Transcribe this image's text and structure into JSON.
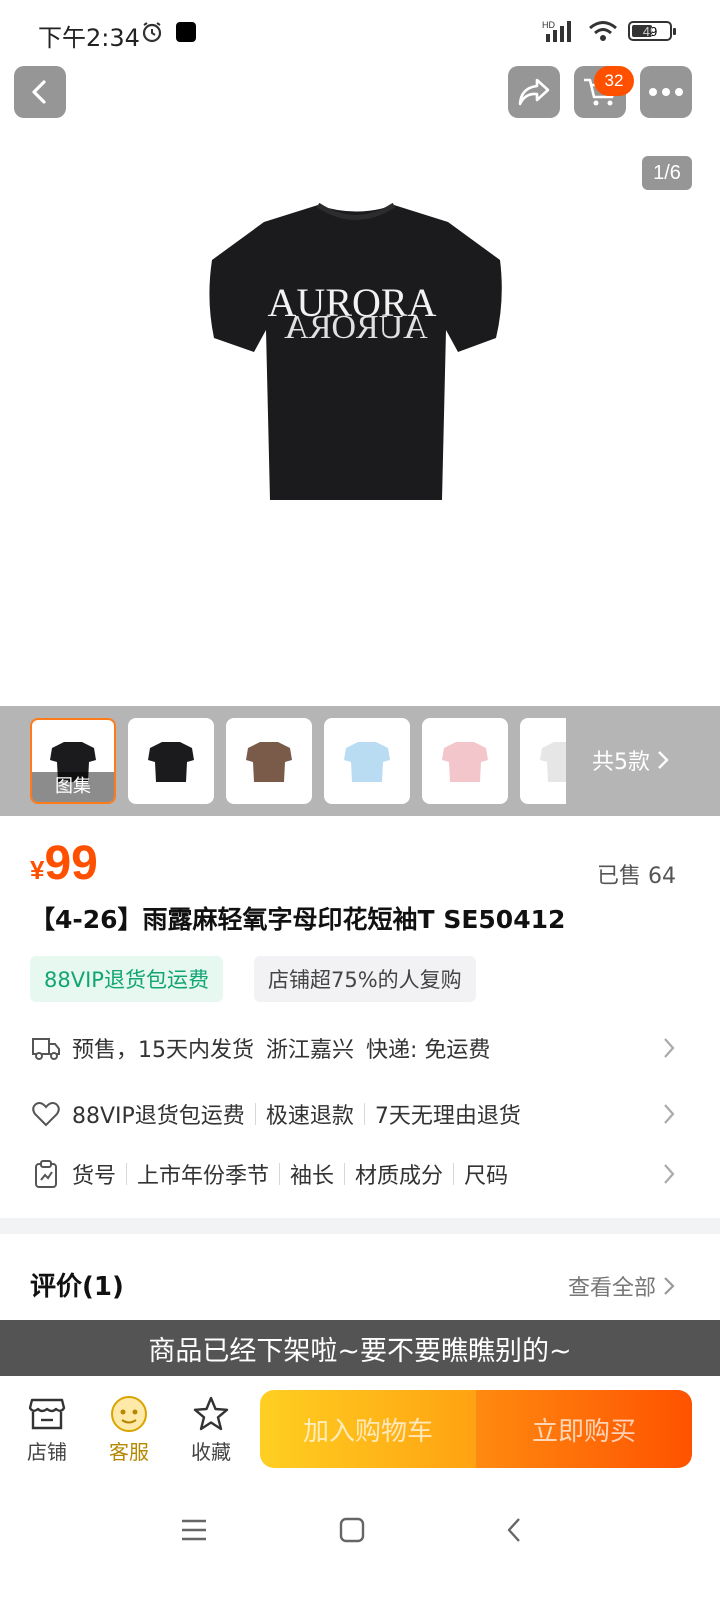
{
  "status_bar": {
    "time": "下午2:34",
    "network": "HD",
    "battery": "49"
  },
  "top_bar": {
    "cart_badge": "32",
    "image_counter": "1/6"
  },
  "hero": {
    "shirt_print_line1": "AURORA",
    "shirt_print_line2": "AURORA",
    "shirt_color": "#1b1b1d"
  },
  "thumbnails": {
    "active_label": "图集",
    "items": [
      {
        "name": "atlas",
        "color": "#1b1b1d"
      },
      {
        "name": "black",
        "color": "#1b1b1d"
      },
      {
        "name": "brown",
        "color": "#7a5a48"
      },
      {
        "name": "light-blue",
        "color": "#b9dcf3"
      },
      {
        "name": "pink",
        "color": "#f2c6cb"
      },
      {
        "name": "white",
        "color": "#eaeaea"
      }
    ],
    "styles_count": "共5款"
  },
  "product": {
    "currency": "¥",
    "price": "99",
    "sold": "已售 64",
    "title": "【4-26】雨露麻轻氧字母印花短袖T SE50412",
    "tag_vip": "88VIP退货包运费",
    "tag_repurchase": "店铺超75%的人复购"
  },
  "info_rows": {
    "shipping": {
      "presale": "预售，15天内发货",
      "origin": "浙江嘉兴",
      "courier": "快递: 免运费"
    },
    "service": [
      "88VIP退货包运费",
      "极速退款",
      "7天无理由退货"
    ],
    "params": [
      "货号",
      "上市年份季节",
      "袖长",
      "材质成分",
      "尺码"
    ]
  },
  "reviews": {
    "title": "评价(1)",
    "view_all": "查看全部"
  },
  "notice": "商品已经下架啦~要不要瞧瞧别的~",
  "bottom_bar": {
    "shop": "店铺",
    "service": "客服",
    "favorite": "收藏",
    "add_to_cart": "加入购物车",
    "buy_now": "立即购买"
  },
  "colors": {
    "accent": "#ff5000",
    "vip_green": "#12a574",
    "cart_button": "#ffb21a",
    "buy_button": "#ff6a08"
  }
}
